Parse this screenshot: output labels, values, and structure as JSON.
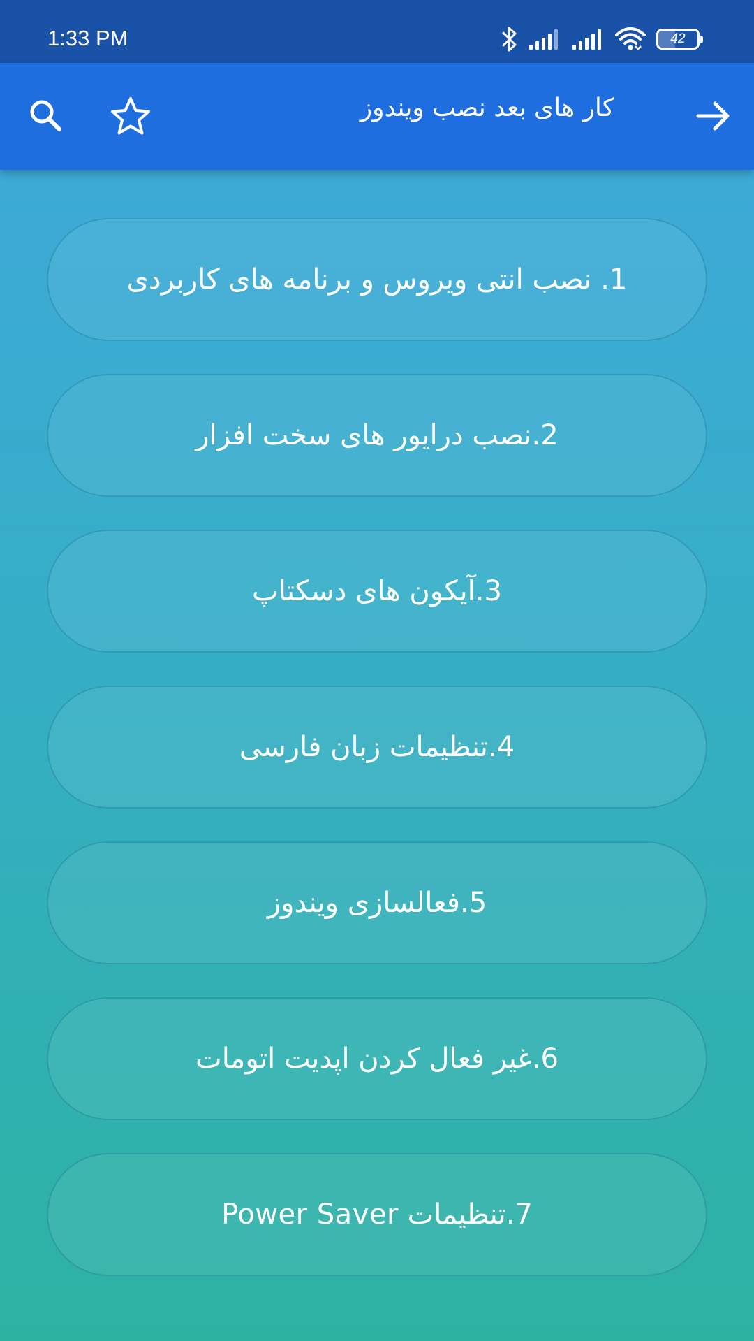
{
  "status_bar": {
    "time": "1:33 PM",
    "battery_level": "42",
    "icons": [
      "bluetooth-icon",
      "signal-icon",
      "signal-icon",
      "wifi-icon",
      "battery-icon"
    ]
  },
  "app_bar": {
    "title": "کار های بعد نصب ویندوز",
    "icons": [
      "search-icon",
      "star-icon",
      "arrow-forward-icon"
    ],
    "color": "#1e6ee0"
  },
  "status_bar_color": "#1a52a8",
  "items": [
    {
      "label": "1. نصب انتی ویروس و برنامه های کاربردی"
    },
    {
      "label": "2.نصب درایور های سخت افزار"
    },
    {
      "label": "3.آیکون های دسکتاپ"
    },
    {
      "label": "4.تنظیمات زبان فارسی"
    },
    {
      "label": "5.فعالسازی ویندوز"
    },
    {
      "label": "6.غیر فعال کردن اپدیت اتومات"
    },
    {
      "label": "7.تنظیمات Power Saver"
    }
  ]
}
